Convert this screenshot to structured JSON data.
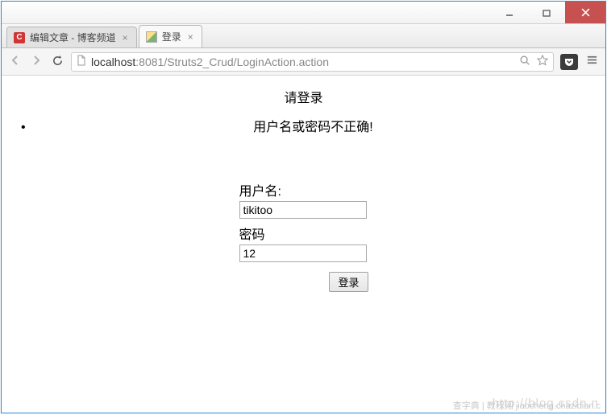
{
  "window": {
    "minimize": "–",
    "maximize": "▭",
    "close": "✕"
  },
  "tabs": [
    {
      "title": "编辑文章 - 博客频道",
      "active": false
    },
    {
      "title": "登录",
      "active": true
    }
  ],
  "toolbar": {
    "url_host": "localhost",
    "url_port": ":8081",
    "url_path": "/Struts2_Crud/LoginAction.action"
  },
  "page": {
    "heading": "请登录",
    "error_message": "用户名或密码不正确!",
    "username_label": "用户名:",
    "username_value": "tikitoo",
    "password_label": "密码",
    "password_value": "12",
    "submit_label": "登录"
  },
  "watermark": "http://blog.csdn.n",
  "watermark2": "查字典 | 教程网  jiaocheng.chazidian.c"
}
